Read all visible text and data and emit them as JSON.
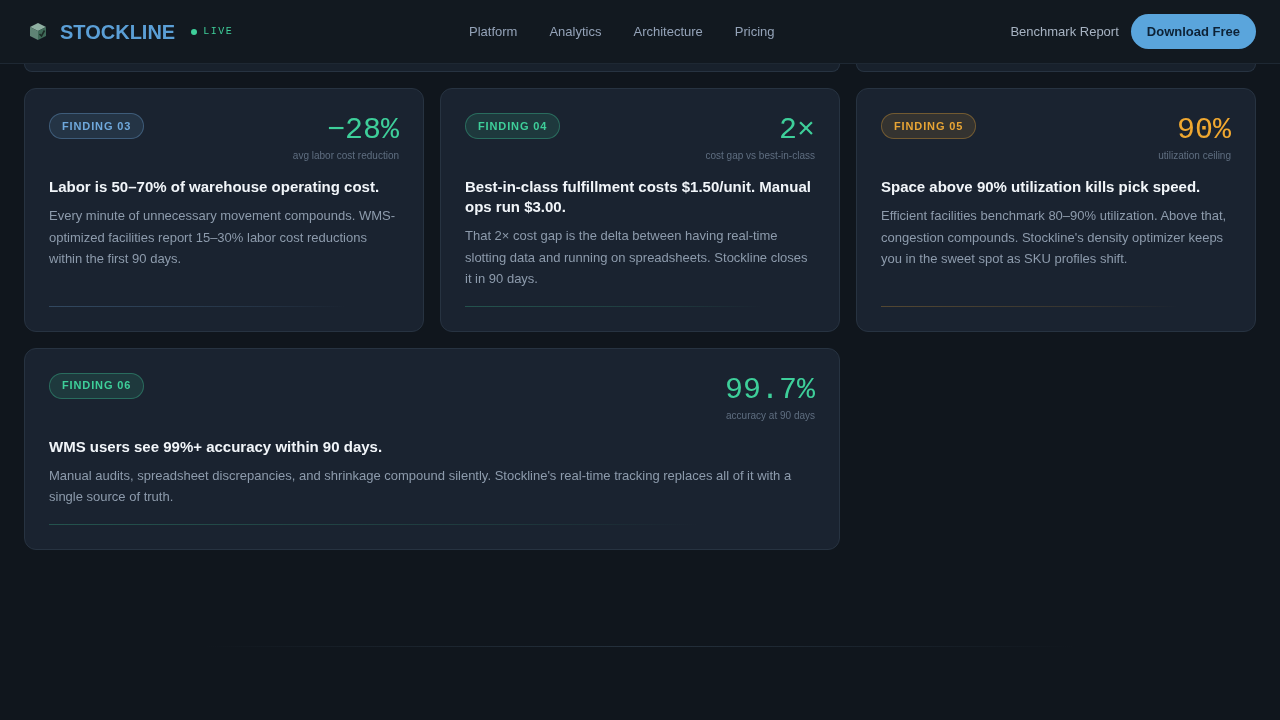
{
  "header": {
    "brand": "STOCKLINE",
    "status": "LIVE",
    "nav": [
      {
        "label": "Platform"
      },
      {
        "label": "Analytics"
      },
      {
        "label": "Architecture"
      },
      {
        "label": "Pricing"
      }
    ],
    "secondary_link": "Benchmark Report",
    "cta": "Download Free"
  },
  "cards_above": [
    {
      "kind": "wide"
    },
    {
      "kind": "standard"
    }
  ],
  "findings": [
    {
      "kind": "standard",
      "badge": {
        "label": "FINDING 03",
        "color": "#6fa8dc"
      },
      "stat": {
        "value": "−28%",
        "label": "avg labor cost reduction",
        "color": "#3ecf9a"
      },
      "title": "Labor is 50–70% of warehouse operating cost.",
      "body": "Every minute of unnecessary movement compounds. WMS-optimized facilities report 15–30% labor cost reductions within the first 90 days."
    },
    {
      "kind": "standard",
      "badge": {
        "label": "FINDING 04",
        "color": "#3ecf9a"
      },
      "stat": {
        "value": "2×",
        "label": "cost gap vs best-in-class",
        "color": "#3ecf9a"
      },
      "title": "Best-in-class fulfillment costs $1.50/unit. Manual ops run $3.00.",
      "body": "That 2× cost gap is the delta between having real-time slotting data and running on spreadsheets. Stockline closes it in 90 days."
    },
    {
      "kind": "standard",
      "badge": {
        "label": "FINDING 05",
        "color": "#e8a535"
      },
      "stat": {
        "value": "90%",
        "label": "utilization ceiling",
        "color": "#f0a830"
      },
      "title": "Space above 90% utilization kills pick speed.",
      "body": "Efficient facilities benchmark 80–90% utilization. Above that, congestion compounds. Stockline's density optimizer keeps you in the sweet spot as SKU profiles shift."
    },
    {
      "kind": "wide",
      "badge": {
        "label": "FINDING 06",
        "color": "#3ecf9a"
      },
      "stat": {
        "value": "99.7%",
        "label": "accuracy at 90 days",
        "color": "#3ecf9a"
      },
      "title": "WMS users see 99%+ accuracy within 90 days.",
      "body": "Manual audits, spreadsheet discrepancies, and shrinkage compound silently. Stockline's real-time tracking replaces all of it with a single source of truth."
    }
  ]
}
